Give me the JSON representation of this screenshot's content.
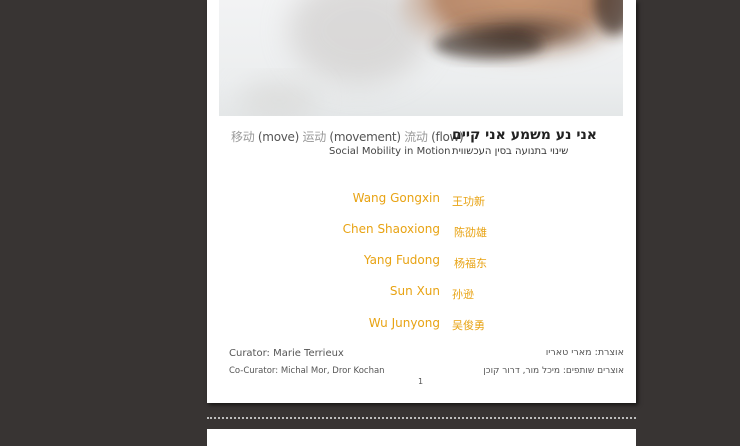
{
  "document": {
    "title_zh_parts": [
      {
        "text": "移动",
        "cn": true
      },
      {
        "text": " (move) ",
        "cn": false
      },
      {
        "text": "运动",
        "cn": true
      },
      {
        "text": " (movement) ",
        "cn": false
      },
      {
        "text": "流动",
        "cn": true
      },
      {
        "text": " (flow)",
        "cn": false
      }
    ],
    "subtitle_en": "Social Mobility in Motion",
    "title_he": "אני נע משמע אני קיים",
    "subtitle_he": "שינוי בתנועה בסין העכשווית",
    "artists": [
      {
        "en": "Wang Gongxin",
        "cn": "王功新"
      },
      {
        "en": "Chen Shaoxiong",
        "cn": "陈劭雄"
      },
      {
        "en": "Yang Fudong",
        "cn": "杨福东"
      },
      {
        "en": "Sun Xun",
        "cn": "孙逊"
      },
      {
        "en": "Wu Junyong",
        "cn": "吴俊勇"
      }
    ],
    "curator_en": "Curator: Marie Terrieux",
    "cocurator_en": "Co-Curator: Michal Mor, Dror Kochan",
    "curator_he": "אוצרת: מארי טאריו",
    "cocurator_he": "אוצרים שותפים: מיכל מור, דרור קוכן",
    "page_number": "1"
  },
  "colors": {
    "background": "#383433",
    "accent": "#e8a313"
  }
}
